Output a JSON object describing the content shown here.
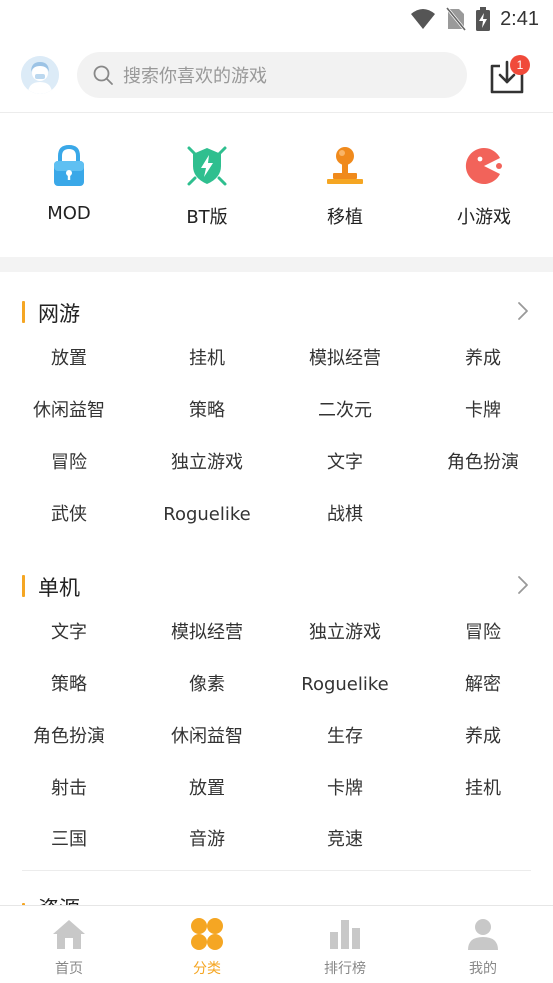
{
  "status_bar": {
    "time": "2:41",
    "icons": [
      "wifi-icon",
      "no-sim-icon",
      "battery-charging-icon"
    ]
  },
  "header": {
    "avatar_icon": "user-avatar",
    "search_placeholder": "搜索你喜欢的游戏",
    "download_icon": "download-icon",
    "download_badge": "1"
  },
  "quick_categories": [
    {
      "label": "MOD",
      "icon": "lock-icon"
    },
    {
      "label": "BT版",
      "icon": "bt-shield-icon"
    },
    {
      "label": "移植",
      "icon": "joystick-icon"
    },
    {
      "label": "小游戏",
      "icon": "pacman-icon"
    }
  ],
  "sections": [
    {
      "title": "网游",
      "tags": [
        "放置",
        "挂机",
        "模拟经营",
        "养成",
        "休闲益智",
        "策略",
        "二次元",
        "卡牌",
        "冒险",
        "独立游戏",
        "文字",
        "角色扮演",
        "武侠",
        "Roguelike",
        "战棋"
      ]
    },
    {
      "title": "单机",
      "tags": [
        "文字",
        "模拟经营",
        "独立游戏",
        "冒险",
        "策略",
        "像素",
        "Roguelike",
        "解密",
        "角色扮演",
        "休闲益智",
        "生存",
        "养成",
        "射击",
        "放置",
        "卡牌",
        "挂机",
        "三国",
        "音游",
        "竞速"
      ]
    },
    {
      "title": "资源"
    }
  ],
  "bottom_nav": [
    {
      "label": "首页",
      "icon": "home-icon",
      "active": false
    },
    {
      "label": "分类",
      "icon": "category-icon",
      "active": true
    },
    {
      "label": "排行榜",
      "icon": "ranking-icon",
      "active": false
    },
    {
      "label": "我的",
      "icon": "profile-icon",
      "active": false
    }
  ],
  "colors": {
    "accent": "#f5a623",
    "badge": "#f04a3a",
    "inactive": "#c8c8c8"
  }
}
